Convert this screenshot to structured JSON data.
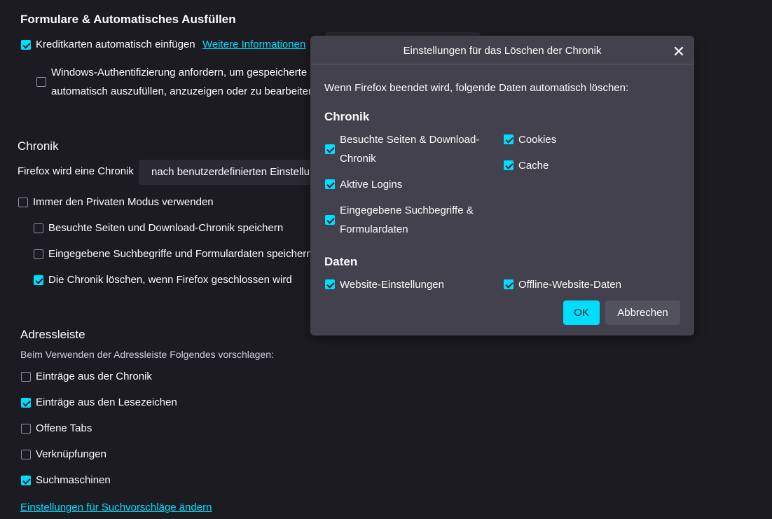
{
  "forms": {
    "heading": "Formulare & Automatisches Ausfüllen",
    "credit_cards": "Kreditkarten automatisch einfügen",
    "more_info": "Weitere Informationen",
    "win_auth_line1": "Windows-Authentifizierung anfordern, um gespeicherte",
    "win_auth_line2": "automatisch auszufüllen, anzuzeigen oder zu bearbeiten"
  },
  "history": {
    "heading": "Chronik",
    "will_label": "Firefox wird eine Chronik",
    "select_value": "nach benutzerdefinierten Einstellungen anlegen",
    "private_mode": "Immer den Privaten Modus verwenden",
    "save_visited": "Besuchte Seiten und Download-Chronik speichern",
    "save_search": "Eingegebene Suchbegriffe und Formulardaten speichern",
    "clear_on_close": "Die Chronik löschen, wenn Firefox geschlossen wird"
  },
  "addressbar": {
    "heading": "Adressleiste",
    "subheading": "Beim Verwenden der Adressleiste Folgendes vorschlagen:",
    "history_entries": "Einträge aus der Chronik",
    "bookmark_entries": "Einträge aus den Lesezeichen",
    "open_tabs": "Offene Tabs",
    "shortcuts": "Verknüpfungen",
    "search_engines": "Suchmaschinen",
    "suggest_link": "Einstellungen für Suchvorschläge ändern"
  },
  "dialog": {
    "title": "Einstellungen für das Löschen der Chronik",
    "close_glyph": "✕",
    "intro": "Wenn Firefox beendet wird, folgende Daten automatisch löschen:",
    "chronik_heading": "Chronik",
    "visited_line1": "Besuchte Seiten & Download-",
    "visited_line2": "Chronik",
    "cookies": "Cookies",
    "cache": "Cache",
    "active_logins": "Aktive Logins",
    "search_line1": "Eingegebene Suchbegriffe &",
    "search_line2": "Formulardaten",
    "daten_heading": "Daten",
    "site_settings": "Website-Einstellungen",
    "offline_data": "Offline-Website-Daten",
    "ok": "OK",
    "cancel": "Abbrechen"
  },
  "colors": {
    "background": "#1c1b22",
    "dialog": "#42414d",
    "accent": "#00ddff"
  }
}
